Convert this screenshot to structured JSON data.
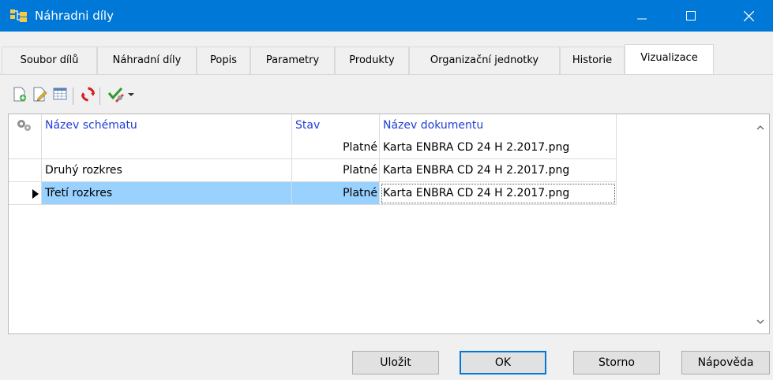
{
  "window": {
    "title": "Náhradni díly",
    "title_bar_color": "#0078d7"
  },
  "tabs": [
    {
      "label": "Soubor dílů"
    },
    {
      "label": "Náhradní díly"
    },
    {
      "label": "Popis"
    },
    {
      "label": "Parametry"
    },
    {
      "label": "Produkty"
    },
    {
      "label": "Organizační jednotky"
    },
    {
      "label": "Historie"
    },
    {
      "label": "Vizualizace",
      "active": true
    }
  ],
  "toolbar": {
    "icons": [
      "new-icon",
      "edit-icon",
      "table-icon",
      "refresh-icon",
      "check-tools-icon",
      "dropdown-arrow-icon"
    ]
  },
  "grid": {
    "columns": {
      "name": "Název schématu",
      "status": "Stav",
      "document": "Název dokumentu"
    },
    "rows": [
      {
        "name": "",
        "status": "Platné",
        "document": "Karta ENBRA CD 24 H 2.2017.png"
      },
      {
        "name": "Druhý rozkres",
        "status": "Platné",
        "document": "Karta ENBRA CD 24 H 2.2017.png"
      },
      {
        "name": "Třetí rozkres",
        "status": "Platné",
        "document": "Karta ENBRA CD 24 H 2.2017.png",
        "selected": true
      }
    ],
    "selection_color": "#99d1ff"
  },
  "footer": {
    "save_label": "Uložit",
    "ok_label": "OK",
    "cancel_label": "Storno",
    "help_label": "Nápověda"
  }
}
